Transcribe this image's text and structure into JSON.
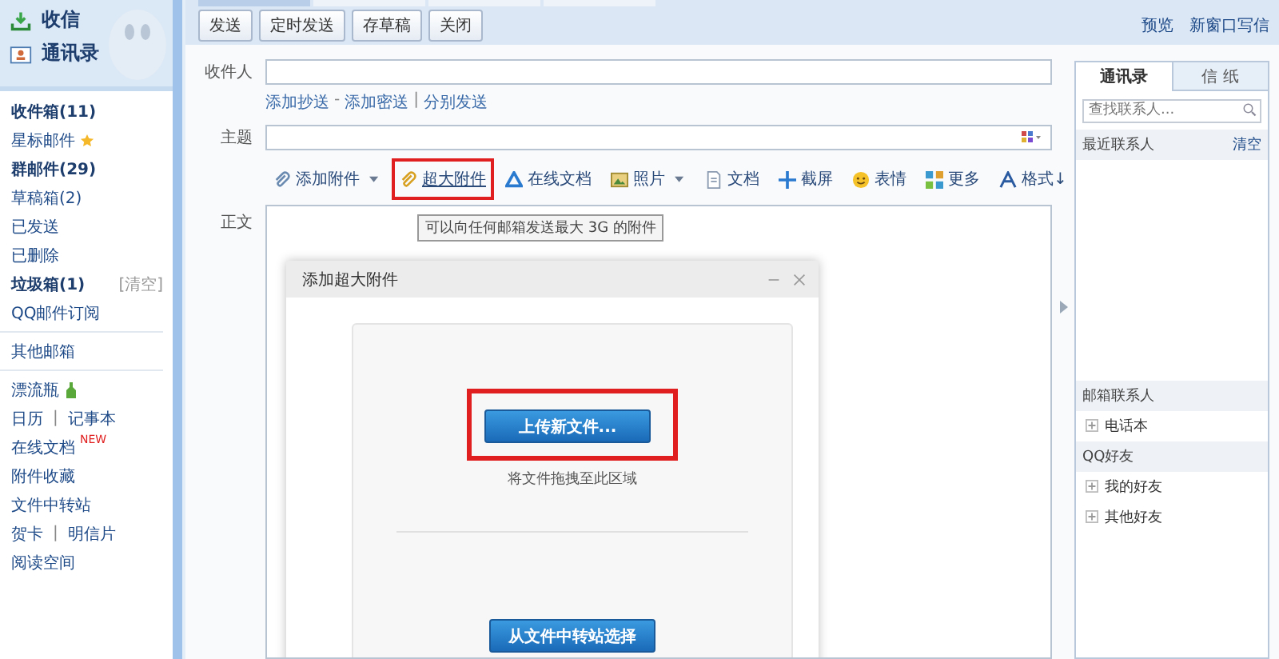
{
  "top_tabs": [
    {
      "selected": true
    },
    {
      "selected": false
    },
    {
      "selected": false
    },
    {
      "selected": false
    }
  ],
  "sidebar": {
    "header": [
      {
        "label": "收信",
        "kind": "inbox"
      },
      {
        "label": "通讯录",
        "kind": "contacts"
      }
    ],
    "folders": [
      {
        "label": "收件箱(11)",
        "bold": true
      },
      {
        "label": "星标邮件",
        "bold": false,
        "kind": "starred"
      },
      {
        "label": "群邮件(29)",
        "bold": true
      },
      {
        "label": "草稿箱(2)",
        "bold": false
      },
      {
        "label": "已发送",
        "bold": false
      },
      {
        "label": "已删除",
        "bold": false
      },
      {
        "label": "垃圾箱(1)",
        "bold": true,
        "action": "[清空]"
      },
      {
        "label": "QQ邮件订阅",
        "bold": false
      }
    ],
    "other": [
      {
        "label": "其他邮箱"
      }
    ],
    "apps": [
      {
        "links": [
          "漂流瓶"
        ],
        "kind": "bottle"
      },
      {
        "links": [
          "日历",
          "记事本"
        ],
        "sep": "|"
      },
      {
        "links": [
          "在线文档"
        ],
        "badge": "NEW"
      },
      {
        "links": [
          "附件收藏"
        ]
      },
      {
        "links": [
          "文件中转站"
        ]
      },
      {
        "links": [
          "贺卡",
          "明信片"
        ],
        "sep": "|"
      },
      {
        "links": [
          "阅读空间"
        ]
      }
    ]
  },
  "toolbar": {
    "buttons": [
      "发送",
      "定时发送",
      "存草稿",
      "关闭"
    ],
    "links": [
      "预览",
      "新窗口写信"
    ]
  },
  "form": {
    "to_label": "收件人",
    "cc_links": [
      {
        "label": "添加抄送"
      },
      {
        "sep": "-",
        "label": "添加密送"
      },
      {
        "sep": "|",
        "label": "分别发送"
      }
    ],
    "subject_label": "主题",
    "body_label": "正文",
    "attach_tools": [
      {
        "label": "添加附件",
        "kind": "attachment",
        "dropdown": true,
        "highlighted": false
      },
      {
        "label": "超大附件",
        "kind": "large-attachment",
        "dropdown": false,
        "highlighted": true
      },
      {
        "label": "在线文档",
        "kind": "online-doc",
        "dropdown": false,
        "highlighted": false
      },
      {
        "label": "照片",
        "kind": "photo",
        "dropdown": true,
        "highlighted": false
      },
      {
        "label": "文档",
        "kind": "doc",
        "dropdown": false,
        "highlighted": false
      },
      {
        "label": "截屏",
        "kind": "screenshot",
        "dropdown": false,
        "highlighted": false
      },
      {
        "label": "表情",
        "kind": "emoji",
        "dropdown": false,
        "highlighted": false
      },
      {
        "label": "更多",
        "kind": "more",
        "dropdown": false,
        "highlighted": false
      },
      {
        "label": "格式↓",
        "kind": "format",
        "dropdown": false,
        "highlighted": false
      }
    ],
    "tooltip": "可以向任何邮箱发送最大 3G 的附件"
  },
  "dialog": {
    "title": "添加超大附件",
    "upload_button": "上传新文件...",
    "upload_highlighted": true,
    "drop_hint": "将文件拖拽至此区域",
    "transfer_button": "从文件中转站选择"
  },
  "contacts_panel": {
    "tabs": [
      {
        "label": "通讯录",
        "selected": true
      },
      {
        "label": "信 纸",
        "selected": false
      }
    ],
    "search": {
      "placeholder": "查找联系人..."
    },
    "recent": {
      "title": "最近联系人",
      "action": "清空"
    },
    "groups": [
      {
        "title": "邮箱联系人",
        "items": [
          "电话本"
        ]
      },
      {
        "title": "QQ好友",
        "items": [
          "我的好友",
          "其他好友"
        ]
      }
    ]
  }
}
